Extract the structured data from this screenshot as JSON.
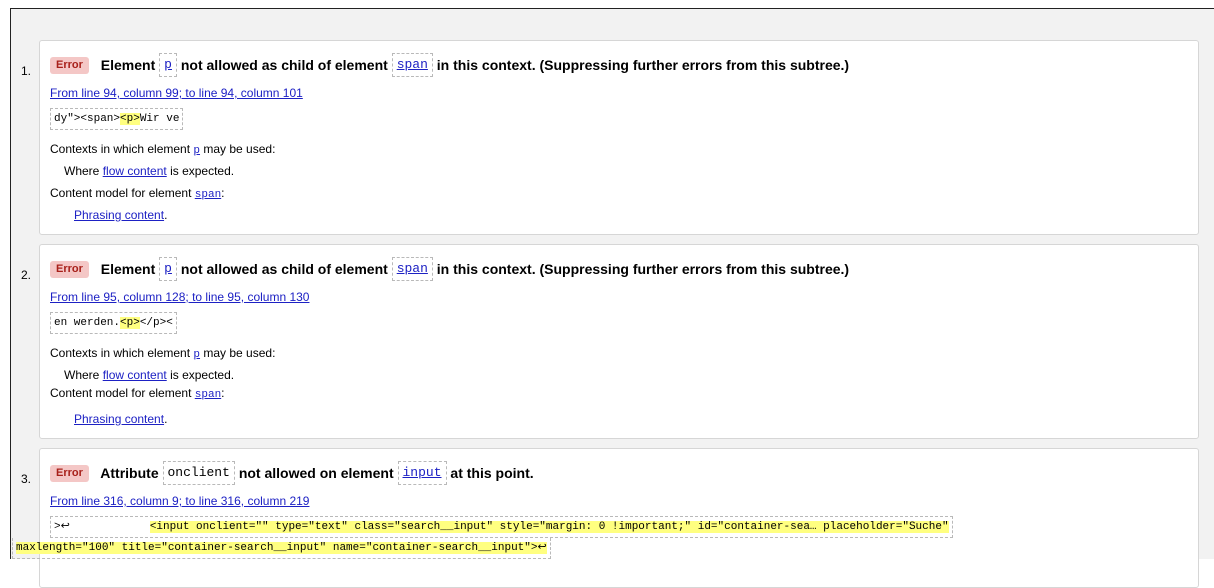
{
  "messages": [
    {
      "number": "1.",
      "badge": "Error",
      "title_pre": "Element",
      "code1": "p",
      "title_mid": "not allowed as child of element",
      "code2": "span",
      "title_post": "in this context. (Suppressing further errors from this subtree.)",
      "location": "From line 94, column 99; to line 94, column 101",
      "extract_pre": "dy\"><span>",
      "extract_hl": "<p>",
      "extract_post": "Wir ve",
      "contexts_pre": "Contexts in which element",
      "contexts_code": "p",
      "contexts_post": "may be used:",
      "where_pre": "Where",
      "where_link": "flow content",
      "where_post": "is expected.",
      "model_pre": "Content model for element",
      "model_code": "span",
      "model_post": ":",
      "model_link": "Phrasing content",
      "model_end": "."
    },
    {
      "number": "2.",
      "badge": "Error",
      "title_pre": "Element",
      "code1": "p",
      "title_mid": "not allowed as child of element",
      "code2": "span",
      "title_post": "in this context. (Suppressing further errors from this subtree.)",
      "location": "From line 95, column 128; to line 95, column 130",
      "extract_pre": "en werden.",
      "extract_hl": "<p>",
      "extract_post": "</p><",
      "contexts_pre": "Contexts in which element",
      "contexts_code": "p",
      "contexts_post": "may be used:",
      "where_pre": "Where",
      "where_link": "flow content",
      "where_post": "is expected.",
      "model_pre": "Content model for element",
      "model_code": "span",
      "model_post": ":",
      "model_link": "Phrasing content",
      "model_end": "."
    },
    {
      "number": "3.",
      "badge": "Error",
      "title_pre": "Attribute",
      "code1": "onclient",
      "title_mid": "not allowed on element",
      "code2": "input",
      "title_post": "at this point.",
      "location": "From line 316, column 9; to line 316, column 219",
      "extract_line1_pre": ">↩",
      "extract_line1_hl": "<input onclient=\"\" type=\"text\" class=\"search__input\" style=\"margin: 0 !important;\" id=\"container-sea… placeholder=\"Suche\"",
      "extract_line2": "maxlength=\"100\" title=\"container-search__input\" name=\"container-search__input\">↩"
    }
  ]
}
